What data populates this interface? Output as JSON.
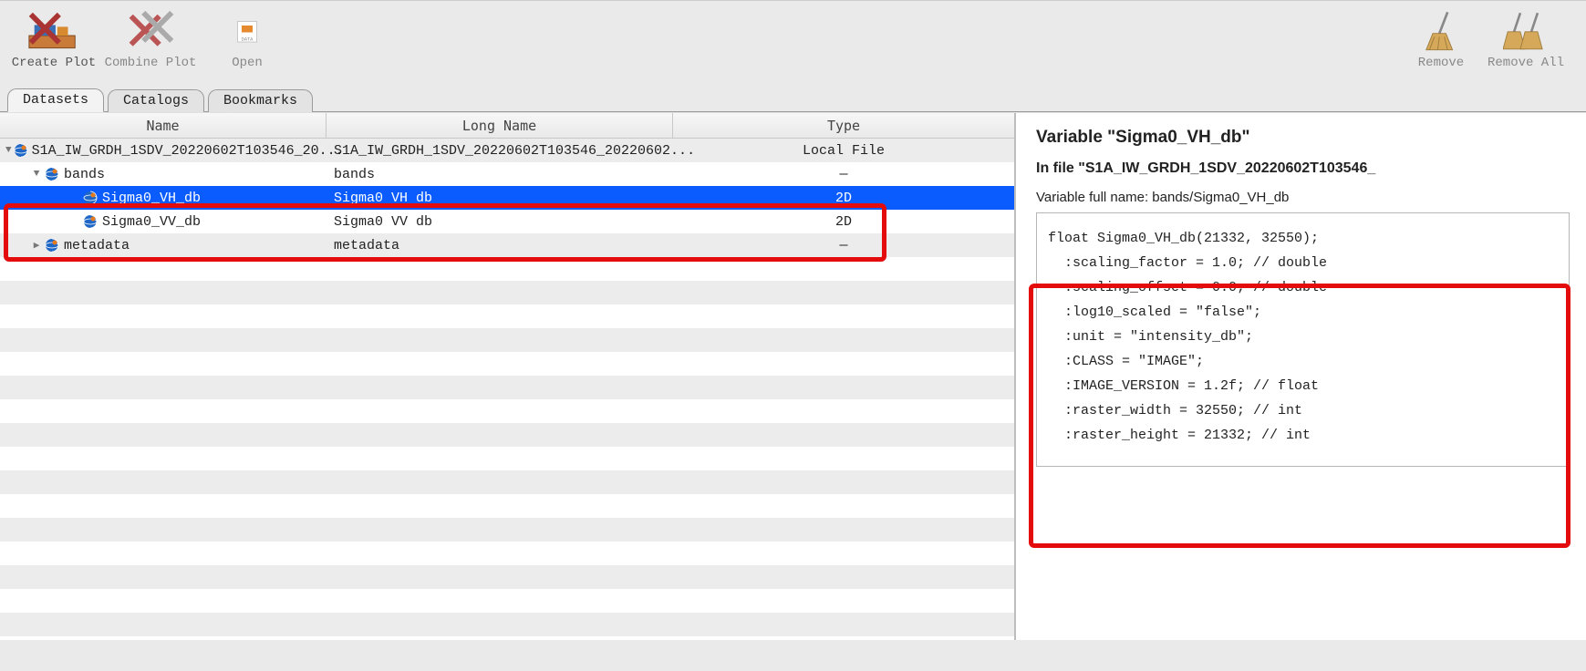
{
  "toolbar": {
    "create_plot": "Create Plot",
    "combine_plot": "Combine Plot",
    "open": "Open",
    "remove": "Remove",
    "remove_all": "Remove All"
  },
  "tabs": {
    "datasets": "Datasets",
    "catalogs": "Catalogs",
    "bookmarks": "Bookmarks",
    "active": "datasets"
  },
  "tree": {
    "headers": {
      "name": "Name",
      "long": "Long Name",
      "type": "Type"
    },
    "rows": [
      {
        "indent": 0,
        "expanded": true,
        "icon": "globe",
        "name": "S1A_IW_GRDH_1SDV_20220602T103546_20...",
        "long": "S1A_IW_GRDH_1SDV_20220602T103546_20220602...",
        "type": "Local File",
        "selected": false
      },
      {
        "indent": 1,
        "expanded": true,
        "icon": "globe",
        "name": "bands",
        "long": "bands",
        "type": "—",
        "selected": false
      },
      {
        "indent": 2,
        "expanded": null,
        "icon": "globe",
        "name": "Sigma0_VH_db",
        "long": "Sigma0 VH db",
        "type": "2D",
        "selected": true
      },
      {
        "indent": 2,
        "expanded": null,
        "icon": "globe",
        "name": "Sigma0_VV_db",
        "long": "Sigma0 VV db",
        "type": "2D",
        "selected": false
      },
      {
        "indent": 1,
        "expanded": false,
        "icon": "globe",
        "name": "metadata",
        "long": "metadata",
        "type": "—",
        "selected": false
      }
    ]
  },
  "detail": {
    "heading_prefix": "Variable ",
    "heading_value": "\"Sigma0_VH_db\"",
    "file_prefix": "In file ",
    "file_value": "\"S1A_IW_GRDH_1SDV_20220602T103546_",
    "fullname_label": "Variable full name: ",
    "fullname_value": "bands/Sigma0_VH_db",
    "code": "float Sigma0_VH_db(21332, 32550);\n  :scaling_factor = 1.0; // double\n  :scaling_offset = 0.0; // double\n  :log10_scaled = \"false\";\n  :unit = \"intensity_db\";\n  :CLASS = \"IMAGE\";\n  :IMAGE_VERSION = 1.2f; // float\n  :raster_width = 32550; // int\n  :raster_height = 21332; // int"
  }
}
